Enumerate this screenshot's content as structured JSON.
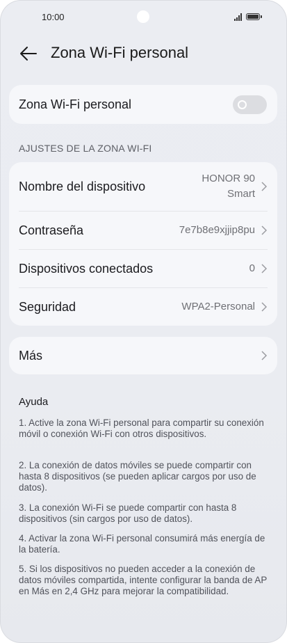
{
  "status_bar": {
    "time": "10:00"
  },
  "header": {
    "title": "Zona Wi-Fi personal"
  },
  "hotspot": {
    "label": "Zona Wi-Fi personal",
    "enabled": false
  },
  "settings": {
    "section_title": "AJUSTES DE LA ZONA WI-FI",
    "device_name": {
      "label": "Nombre del dispositivo",
      "value_line1": "HONOR 90",
      "value_line2": "Smart"
    },
    "password": {
      "label": "Contraseña",
      "value": "7e7b8e9xjjip8pu"
    },
    "connected_devices": {
      "label": "Dispositivos conectados",
      "value": "0"
    },
    "security": {
      "label": "Seguridad",
      "value": "WPA2-Personal"
    }
  },
  "more": {
    "label": "Más"
  },
  "help": {
    "title": "Ayuda",
    "items": [
      "1. Active la zona Wi-Fi personal para compartir su conexión móvil o conexión Wi-Fi con otros dispositivos.",
      "2. La conexión de datos móviles se puede compartir con hasta 8 dispositivos (se pueden aplicar cargos por uso de datos).",
      "3. La conexión Wi-Fi se puede compartir con hasta 8 dispositivos (sin cargos por uso de datos).",
      "4. Activar la zona Wi-Fi personal consumirá más energía de la batería.",
      "5. Si los dispositivos no pueden acceder a la conexión de datos móviles compartida, intente configurar la banda de AP en Más en 2,4 GHz para mejorar la compatibilidad."
    ]
  }
}
